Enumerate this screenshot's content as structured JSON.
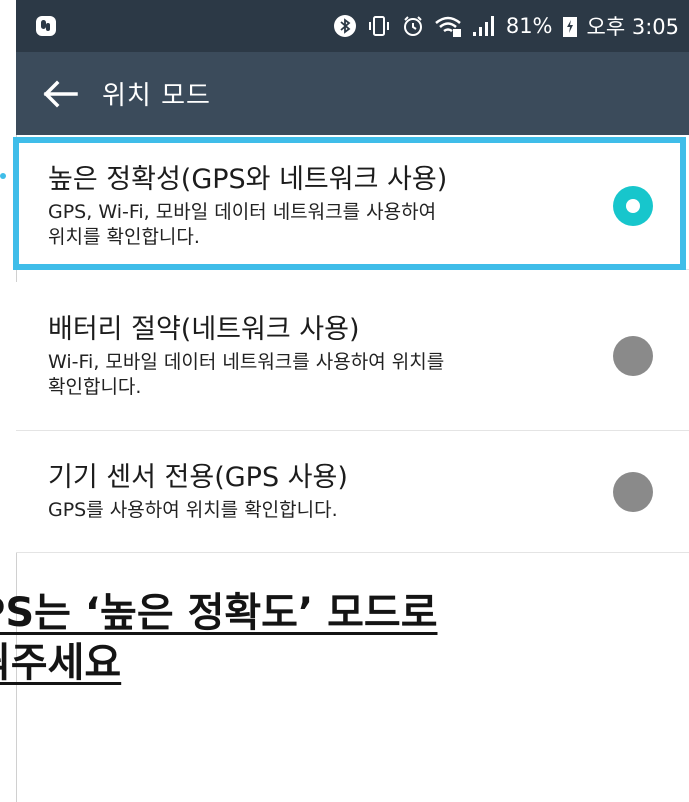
{
  "status_bar": {
    "icons": [
      "app-logo-icon",
      "bluetooth-icon",
      "vibrate-icon",
      "alarm-icon",
      "wifi-icon",
      "signal-icon",
      "battery-icon"
    ],
    "battery": "81%",
    "time": "오후 3:05"
  },
  "app_bar": {
    "back_icon": "arrow-left-icon",
    "title": "위치 모드"
  },
  "options": [
    {
      "title": "높은 정확성(GPS와 네트워크 사용)",
      "desc": "GPS, Wi-Fi, 모바일 데이터 네트워크를 사용하여\n위치를 확인합니다.",
      "selected": true
    },
    {
      "title": "배터리 절약(네트워크 사용)",
      "desc": "Wi-Fi, 모바일 데이터 네트워크를 사용하여 위치를\n확인합니다.",
      "selected": false
    },
    {
      "title": "기기 센서 전용(GPS 사용)",
      "desc": "GPS를 사용하여 위치를 확인합니다.",
      "selected": false
    }
  ],
  "colors": {
    "status_bar": "#2c3946",
    "app_bar": "#3b4b5b",
    "accent": "#17c6cc",
    "highlight": "#3fbde9",
    "radio_off": "#8a8a8a"
  },
  "caption": {
    "line1": "PS는 ‘높은 정확도’ 모드로",
    "line2": "꿔주세요"
  }
}
